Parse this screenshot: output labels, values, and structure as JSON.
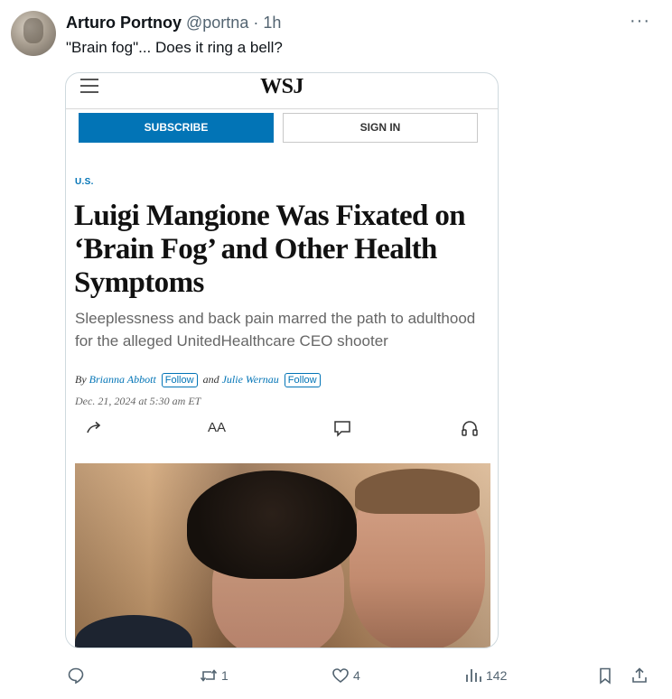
{
  "post": {
    "author_name": "Arturo Portnoy",
    "handle": "@portna",
    "separator": "·",
    "time": "1h",
    "text": "\"Brain fog\"... Does it ring a bell?",
    "more_label": "···"
  },
  "card": {
    "logo": "WSJ",
    "subscribe_label": "SUBSCRIBE",
    "signin_label": "SIGN IN",
    "section": "U.S.",
    "headline": "Luigi Mangione Was Fixated on ‘Brain Fog’ and Other Health Symptoms",
    "dek": "Sleeplessness and back pain marred the path to adulthood for the alleged UnitedHealthcare CEO shooter",
    "byline_by": "By",
    "author_1": "Brianna Abbott",
    "follow_label": "Follow",
    "byline_and": "and",
    "author_2": "Julie Wernau",
    "dateline": "Dec. 21, 2024 at 5:30 am ET",
    "text_size_label": "AA"
  },
  "actions": {
    "reply_count": "",
    "repost_count": "1",
    "like_count": "4",
    "views_count": "142"
  },
  "colors": {
    "wsj_blue": "#0274b6",
    "secondary_text": "#536471",
    "border": "#cfd9de"
  },
  "icons": [
    "more-icon",
    "hamburger-icon",
    "share-icon",
    "text-size-icon",
    "comment-icon",
    "headphones-icon",
    "reply-icon",
    "repost-icon",
    "like-icon",
    "views-icon",
    "bookmark-icon",
    "upload-icon"
  ]
}
